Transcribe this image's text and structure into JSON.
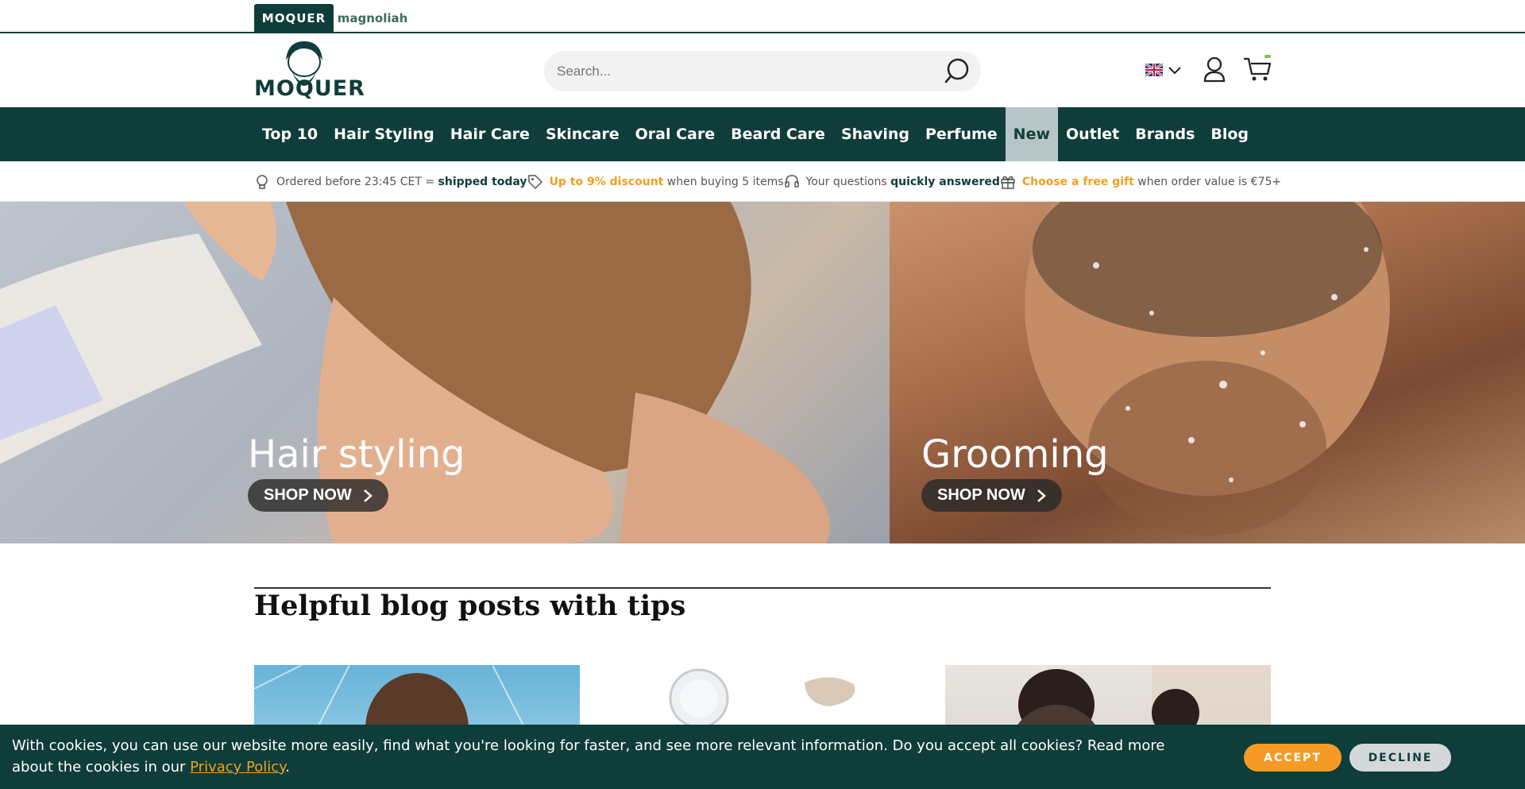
{
  "brandbar": {
    "active": "MOQUER",
    "other": "magnoliah"
  },
  "header": {
    "logo_text": "MOQUER",
    "search_placeholder": "Search...",
    "language_icon": "uk-flag-icon"
  },
  "nav": {
    "items": [
      {
        "label": "Top 10"
      },
      {
        "label": "Hair Styling"
      },
      {
        "label": "Hair Care"
      },
      {
        "label": "Skincare"
      },
      {
        "label": "Oral Care"
      },
      {
        "label": "Beard Care"
      },
      {
        "label": "Shaving"
      },
      {
        "label": "Perfume"
      },
      {
        "label": "New"
      },
      {
        "label": "Outlet"
      },
      {
        "label": "Brands"
      },
      {
        "label": "Blog"
      }
    ],
    "highlighted": "New"
  },
  "usp": [
    {
      "pre": "Ordered before 23:45 CET = ",
      "bold": "shipped today",
      "post": "",
      "icon": "lightbulb-icon"
    },
    {
      "pre": "",
      "bold": "Up to 9% discount",
      "post": " when buying 5 items",
      "icon": "tag-icon"
    },
    {
      "pre": "Your questions ",
      "bold": "quickly answered",
      "post": "",
      "icon": "headset-icon"
    },
    {
      "pre": "",
      "bold": "Choose a free gift",
      "post": " when order value is €75+",
      "icon": "gift-icon"
    }
  ],
  "hero": {
    "left": {
      "title": "Hair styling",
      "button": "SHOP NOW"
    },
    "right": {
      "title": "Grooming",
      "button": "SHOP NOW"
    }
  },
  "blog": {
    "title": "Helpful blog posts with tips"
  },
  "cookie": {
    "text": "With cookies, you can use our website more easily, find what you're looking for faster, and see more relevant information. Do you accept all cookies? Read more about the cookies in our ",
    "link": "Privacy Policy",
    "end": ".",
    "accept": "ACCEPT",
    "decline": "DECLINE"
  },
  "colors": {
    "brand": "#0f3d3a",
    "accent": "#f0a020",
    "nav_highlight": "#b7c5c6"
  }
}
